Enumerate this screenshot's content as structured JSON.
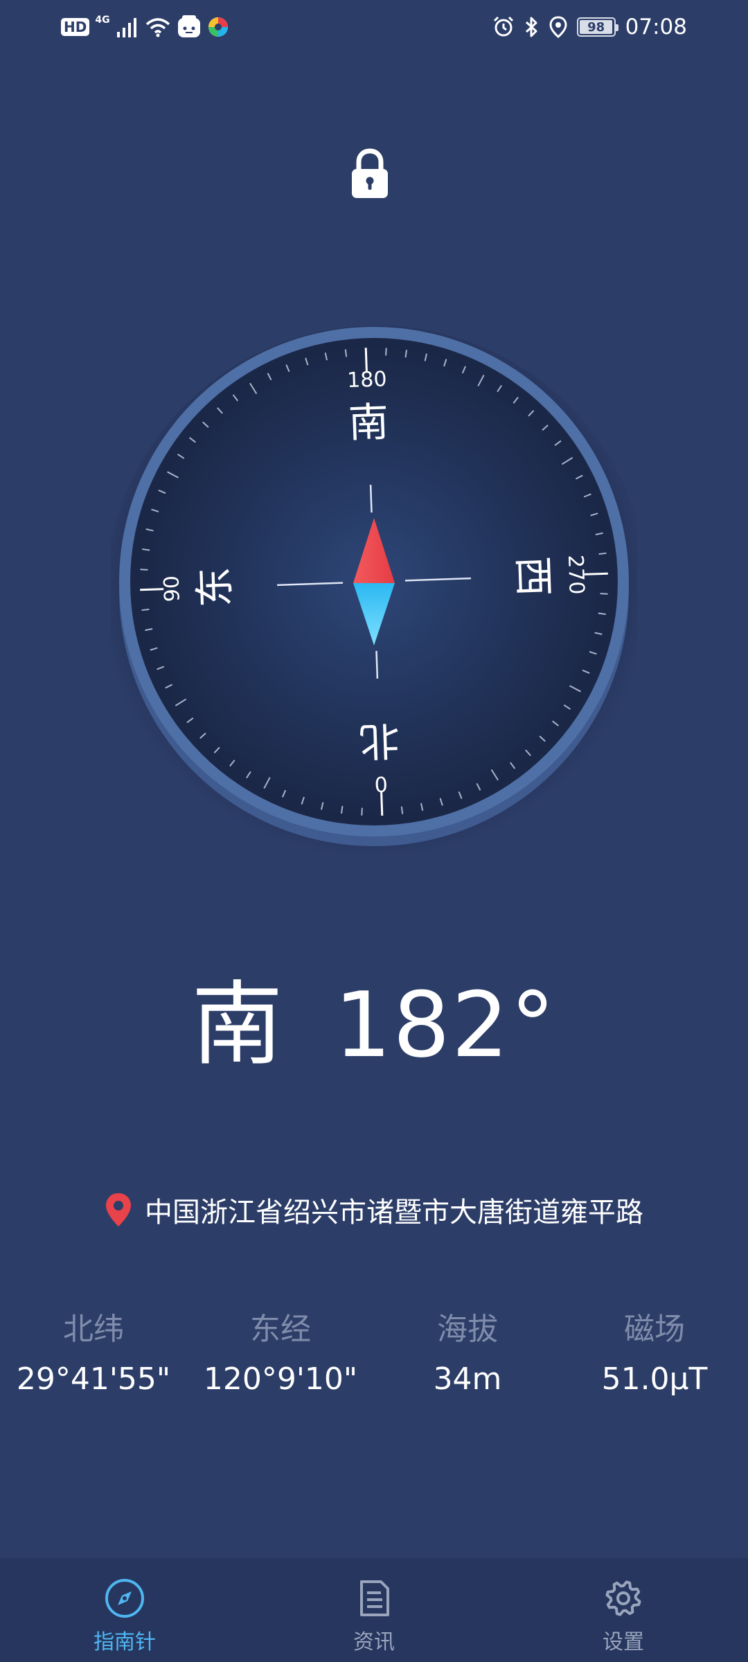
{
  "status_bar": {
    "hd_badge": "HD",
    "network_type": "4G",
    "battery_level": "98",
    "battery_percent": 98,
    "time": "07:08",
    "icons": [
      "signal-icon",
      "wifi-icon",
      "android-app-icon",
      "colorful-app-icon",
      "alarm-icon",
      "bluetooth-icon",
      "location-icon"
    ]
  },
  "compass": {
    "heading_degrees": 182,
    "dial": {
      "labels": [
        {
          "text": "南",
          "degree": "180"
        },
        {
          "text": "西",
          "degree": "270"
        },
        {
          "text": "北",
          "degree": "0"
        },
        {
          "text": "东",
          "degree": "90"
        }
      ]
    },
    "colors": {
      "needle_north": "#ef4a4f",
      "needle_south": "#36c6f2",
      "dial_face": "#1e2b4d",
      "dial_rim": "#4f70a6"
    }
  },
  "reading": {
    "direction": "南",
    "degrees": "182°"
  },
  "location": {
    "address": "中国浙江省绍兴市诸暨市大唐街道雍平路",
    "pin_color": "#e8424a"
  },
  "stats": [
    {
      "label": "北纬",
      "value": "29°41'55\""
    },
    {
      "label": "东经",
      "value": "120°9'10\""
    },
    {
      "label": "海拔",
      "value": "34m"
    },
    {
      "label": "磁场",
      "value": "51.0μT"
    }
  ],
  "bottom_nav": {
    "items": [
      {
        "label": "指南针",
        "icon": "compass-icon",
        "active": true
      },
      {
        "label": "资讯",
        "icon": "document-icon",
        "active": false
      },
      {
        "label": "设置",
        "icon": "gear-icon",
        "active": false
      }
    ],
    "active_color": "#4fb6f1"
  }
}
